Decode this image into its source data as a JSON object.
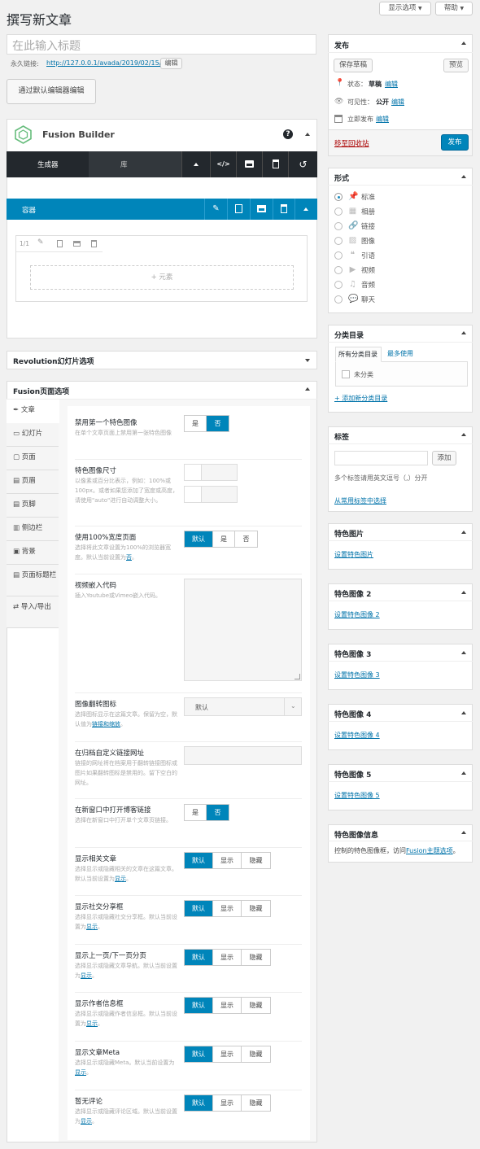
{
  "page": {
    "title": "撰写新文章",
    "screen_options": "显示选项",
    "help": "帮助"
  },
  "post": {
    "title_placeholder": "在此输入标题",
    "permalink_label": "永久链接:",
    "permalink_url": "http://127.0.0.1/avada/2019/02/15/6/",
    "edit_button": "编辑",
    "default_editor_button": "通过默认编辑器编辑"
  },
  "fusion_builder": {
    "title": "Fusion Builder",
    "help_icon": "?",
    "tabs": [
      "生成器",
      "库"
    ],
    "toolbar_icons": [
      "chevron-up-icon",
      "code-icon",
      "save-icon",
      "trash-icon",
      "history-icon"
    ],
    "container_label": "容器",
    "column_label": "1/1",
    "add_element": "+ 元素"
  },
  "revolution": {
    "title": "Revolution幻灯片选项"
  },
  "fusion_page_options": {
    "title": "Fusion页面选项",
    "tabs": [
      "文章",
      "幻灯片",
      "页面",
      "页眉",
      "页脚",
      "侧边栏",
      "背景",
      "页面标题栏",
      "导入/导出"
    ],
    "options": [
      {
        "title": "禁用第一个特色图像",
        "desc": "在单个文章页面上禁用第一张特色图像",
        "choices": [
          "是",
          "否"
        ],
        "selected": "否"
      },
      {
        "title": "特色图像尺寸",
        "desc": "以像素或百分比表示，例如：100%或100px。或者如果您添加了宽度或高度，请使用\"auto\"进行自动调整大小。"
      },
      {
        "title": "使用100%宽度页面",
        "desc_before": "选择将此文章设置为100%的浏览器宽度。默认当前设置为",
        "desc_link": "否",
        "desc_after": "。",
        "choices": [
          "默认",
          "是",
          "否"
        ],
        "selected": "默认"
      },
      {
        "title": "视频嵌入代码",
        "desc": "插入Youtube或Vimeo嵌入代码。"
      },
      {
        "title": "图像翻转图标",
        "desc_before": "选择图标显示在这篇文章。保留为空，默认值为",
        "desc_link": "链接和缩放",
        "desc_after": "。",
        "select_value": "默认"
      },
      {
        "title": "在归档自定义链接网址",
        "desc": "链接的网址将在档案用于翻转链接图标或图片如果翻转图标是禁用的。留下空白的网址。"
      },
      {
        "title": "在新窗口中打开博客链接",
        "desc": "选择在新窗口中打开单个文章页链接。",
        "choices": [
          "是",
          "否"
        ],
        "selected": "否"
      },
      {
        "title": "显示相关文章",
        "desc_before": "选择显示或隐藏相关的文章在这篇文章。默认当前设置为",
        "desc_link": "显示",
        "desc_after": "。",
        "choices": [
          "默认",
          "显示",
          "隐藏"
        ],
        "selected": "默认"
      },
      {
        "title": "显示社交分享框",
        "desc_before": "选择显示或隐藏社交分享框。默认当前设置为",
        "desc_link": "显示",
        "desc_after": "。",
        "choices": [
          "默认",
          "显示",
          "隐藏"
        ],
        "selected": "默认"
      },
      {
        "title": "显示上一页/下一页分页",
        "desc_before": "选择显示或隐藏文章导航。默认当前设置为",
        "desc_link": "显示",
        "desc_after": "。",
        "choices": [
          "默认",
          "显示",
          "隐藏"
        ],
        "selected": "默认"
      },
      {
        "title": "显示作者信息框",
        "desc_before": "选择显示或隐藏作者信息框。默认当前设置为",
        "desc_link": "显示",
        "desc_after": "。",
        "choices": [
          "默认",
          "显示",
          "隐藏"
        ],
        "selected": "默认"
      },
      {
        "title": "显示文章Meta",
        "desc_before": "选择显示或隐藏Meta。默认当前设置为",
        "desc_link": "显示",
        "desc_after": "。",
        "choices": [
          "默认",
          "显示",
          "隐藏"
        ],
        "selected": "默认"
      },
      {
        "title": "暂无评论",
        "desc_before": "选择显示或隐藏评论区域。默认当前设置为",
        "desc_link": "显示",
        "desc_after": "。",
        "choices": [
          "默认",
          "显示",
          "隐藏"
        ],
        "selected": "默认"
      }
    ]
  },
  "publish": {
    "title": "发布",
    "save_draft": "保存草稿",
    "preview": "预览",
    "status_label": "状态：",
    "status_value": "草稿",
    "visibility_label": "可见性：",
    "visibility_value": "公开",
    "schedule_label": "立即发布",
    "edit_link": "编辑",
    "trash": "移至回收站",
    "publish_button": "发布"
  },
  "format": {
    "title": "形式",
    "items": [
      {
        "label": "标准",
        "icon": "pin-icon",
        "selected": true
      },
      {
        "label": "相册",
        "icon": "gallery-icon"
      },
      {
        "label": "链接",
        "icon": "link-icon"
      },
      {
        "label": "图像",
        "icon": "image-icon"
      },
      {
        "label": "引语",
        "icon": "quote-icon"
      },
      {
        "label": "视频",
        "icon": "video-icon"
      },
      {
        "label": "音频",
        "icon": "audio-icon"
      },
      {
        "label": "聊天",
        "icon": "chat-icon"
      }
    ]
  },
  "categories": {
    "title": "分类目录",
    "tabs": [
      "所有分类目录",
      "最多使用"
    ],
    "items": [
      "未分类"
    ],
    "add_new": "+ 添加新分类目录"
  },
  "tags": {
    "title": "标签",
    "add_button": "添加",
    "hint": "多个标签请用英文逗号（,）分开",
    "choose": "从常用标签中选择"
  },
  "featured_images": [
    {
      "title": "特色图片",
      "link": "设置特色图片"
    },
    {
      "title": "特色图像 2",
      "link": "设置特色图像 2"
    },
    {
      "title": "特色图像 3",
      "link": "设置特色图像 3"
    },
    {
      "title": "特色图像 4",
      "link": "设置特色图像 4"
    },
    {
      "title": "特色图像 5",
      "link": "设置特色图像 5"
    }
  ],
  "featured_info": {
    "title": "特色图像信息",
    "text_before": "控制的特色图像框，访问",
    "link": "Fusion主题选项",
    "text_after": "。"
  },
  "colors": {
    "primary": "#0085ba",
    "builder_dark": "#23282d",
    "container_bar": "#0085ba",
    "link": "#0073aa",
    "trash": "#a00"
  }
}
